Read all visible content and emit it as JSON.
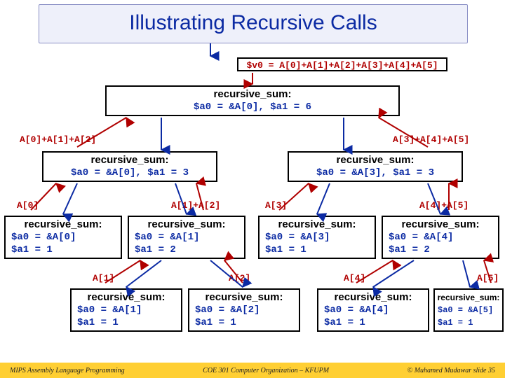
{
  "title": "Illustrating Recursive Calls",
  "root": {
    "result": "$v0 = A[0]+A[1]+A[2]+A[3]+A[4]+A[5]",
    "hdr": "recursive_sum:",
    "args": "$a0 = &A[0], $a1 = 6"
  },
  "level2": {
    "left": {
      "result": "A[0]+A[1]+A[2]",
      "hdr": "recursive_sum:",
      "args": "$a0 = &A[0], $a1 = 3"
    },
    "right": {
      "result": "A[3]+A[4]+A[5]",
      "hdr": "recursive_sum:",
      "args": "$a0 = &A[3], $a1 = 3"
    }
  },
  "level3": {
    "n0": {
      "result": "A[0]",
      "hdr": "recursive_sum:",
      "args": "$a0 = &A[0]\n$a1 = 1"
    },
    "n1": {
      "result": "A[1]+A[2]",
      "hdr": "recursive_sum:",
      "args": "$a0 = &A[1]\n$a1 = 2"
    },
    "n2": {
      "result": "A[3]",
      "hdr": "recursive_sum:",
      "args": "$a0 = &A[3]\n$a1 = 1"
    },
    "n3": {
      "result": "A[4]+A[5]",
      "hdr": "recursive_sum:",
      "args": "$a0 = &A[4]\n$a1 = 2"
    }
  },
  "level4": {
    "n0": {
      "result": "A[1]",
      "hdr": "recursive_sum:",
      "args": "$a0 = &A[1]\n$a1 = 1"
    },
    "n1": {
      "result": "A[2]",
      "hdr": "recursive_sum:",
      "args": "$a0 = &A[2]\n$a1 = 1"
    },
    "n2": {
      "result": "A[4]",
      "hdr": "recursive_sum:",
      "args": "$a0 = &A[4]\n$a1 = 1"
    },
    "n3": {
      "result": "A[5]",
      "hdr": "recursive_sum:",
      "args": "$a0 = &A[5]\n$a1 = 1"
    }
  },
  "footer": {
    "left": "MIPS Assembly Language Programming",
    "center": "COE 301 Computer Organization – KFUPM",
    "right": "© Muhamed Mudawar   slide 35"
  }
}
